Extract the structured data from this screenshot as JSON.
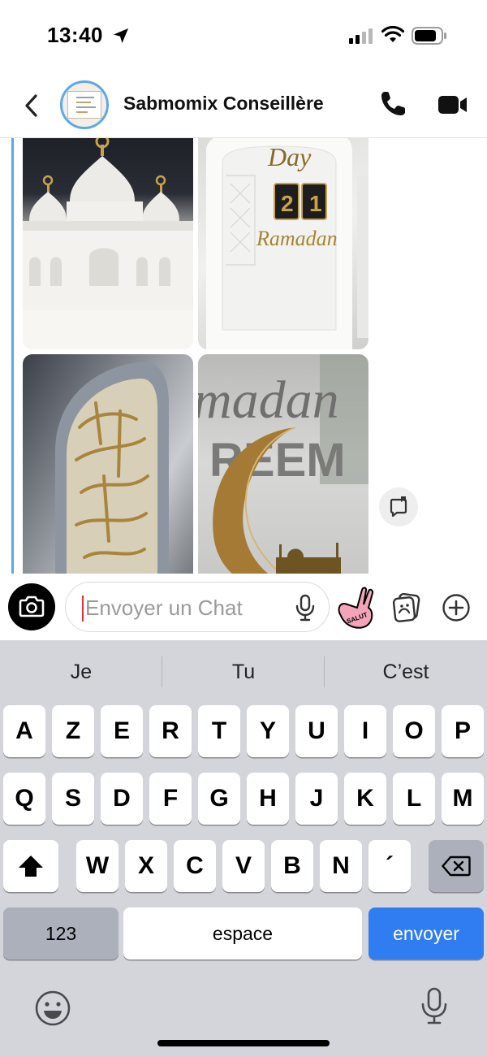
{
  "status_bar": {
    "time": "13:40",
    "icons": [
      "location-arrow-icon",
      "cellular-signal-icon",
      "wifi-icon",
      "battery-icon"
    ]
  },
  "header": {
    "contact_name": "Sabmomix Conseillère",
    "back_icon": "chevron-left-icon",
    "call_icon": "phone-icon",
    "video_icon": "video-camera-icon"
  },
  "chat": {
    "photos": [
      "mosque-decoration",
      "day-counter-ramadan",
      "arabic-calligraphy-arch",
      "ramadan-kareem-crescent"
    ],
    "photo_texts": {
      "day_label": "Day",
      "day_digits": [
        "2",
        "1"
      ],
      "ramadan": "Ramadan",
      "banner": "madan",
      "banner2": "REEM"
    },
    "save_icon": "save-to-chat-icon"
  },
  "input": {
    "placeholder": "Envoyer un Chat",
    "value": "",
    "sticker_text": "SALUT"
  },
  "keyboard": {
    "suggestions": [
      "Je",
      "Tu",
      "C’est"
    ],
    "row1": [
      "A",
      "Z",
      "E",
      "R",
      "T",
      "Y",
      "U",
      "I",
      "O",
      "P"
    ],
    "row2": [
      "Q",
      "S",
      "D",
      "F",
      "G",
      "H",
      "J",
      "K",
      "L",
      "M"
    ],
    "row3": [
      "W",
      "X",
      "C",
      "V",
      "B",
      "N",
      "´"
    ],
    "numbers_label": "123",
    "space_label": "espace",
    "send_label": "envoyer"
  },
  "colors": {
    "accent_blue": "#2f7df0",
    "message_bar": "#5aa6e6",
    "caret": "#e0313b",
    "keyboard_bg": "#d3d5db"
  }
}
